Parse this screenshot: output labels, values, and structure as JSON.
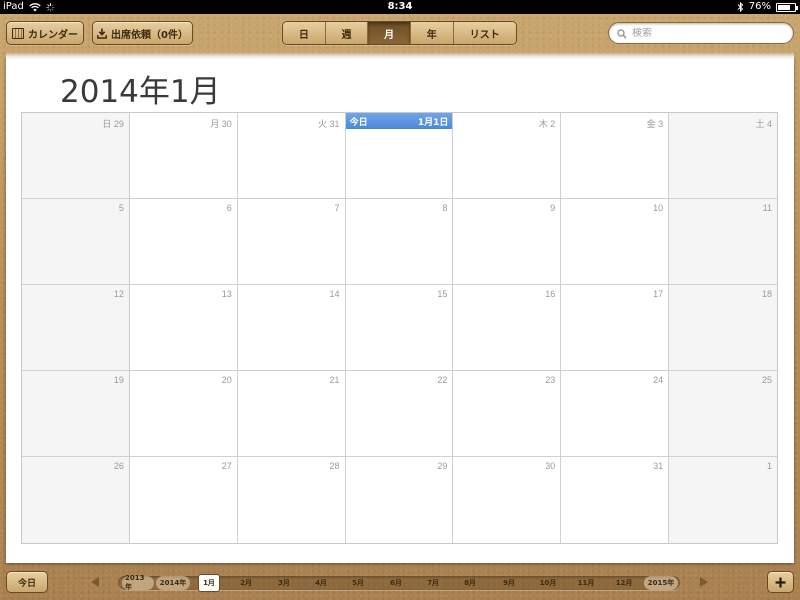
{
  "status_bar": {
    "device": "iPad",
    "time": "8:34",
    "battery": "76%",
    "battery_level": 0.76
  },
  "toolbar": {
    "calendars_label": "カレンダー",
    "invites_label": "出席依頼（0件）",
    "views": [
      {
        "label": "日",
        "active": false
      },
      {
        "label": "週",
        "active": false
      },
      {
        "label": "月",
        "active": true
      },
      {
        "label": "年",
        "active": false
      },
      {
        "label": "リスト",
        "active": false
      }
    ],
    "search_placeholder": "検索"
  },
  "calendar": {
    "month_title": "2014年1月",
    "today_label": "今日",
    "weeks": [
      [
        "日 29",
        "月 30",
        "火 31",
        "1月1日",
        "木 2",
        "金 3",
        "土 4"
      ],
      [
        "5",
        "6",
        "7",
        "8",
        "9",
        "10",
        "11"
      ],
      [
        "12",
        "13",
        "14",
        "15",
        "16",
        "17",
        "18"
      ],
      [
        "19",
        "20",
        "21",
        "22",
        "23",
        "24",
        "25"
      ],
      [
        "26",
        "27",
        "28",
        "29",
        "30",
        "31",
        "1"
      ]
    ],
    "today_cell": {
      "week": 0,
      "day": 3
    }
  },
  "bottom_bar": {
    "today_button": "今日",
    "timeline": [
      {
        "label": "2013年",
        "type": "year"
      },
      {
        "label": "2014年",
        "type": "year"
      },
      {
        "label": "1月",
        "type": "month",
        "selected": true
      },
      {
        "label": "2月",
        "type": "month"
      },
      {
        "label": "3月",
        "type": "month"
      },
      {
        "label": "4月",
        "type": "month"
      },
      {
        "label": "5月",
        "type": "month"
      },
      {
        "label": "6月",
        "type": "month"
      },
      {
        "label": "7月",
        "type": "month"
      },
      {
        "label": "8月",
        "type": "month"
      },
      {
        "label": "9月",
        "type": "month"
      },
      {
        "label": "10月",
        "type": "month"
      },
      {
        "label": "11月",
        "type": "month"
      },
      {
        "label": "12月",
        "type": "month"
      },
      {
        "label": "2015年",
        "type": "year"
      }
    ],
    "add_button": "+"
  },
  "colors": {
    "leather": "#b8935d",
    "today_blue": "#5a93de",
    "active_segment": "#7a5a2e"
  }
}
